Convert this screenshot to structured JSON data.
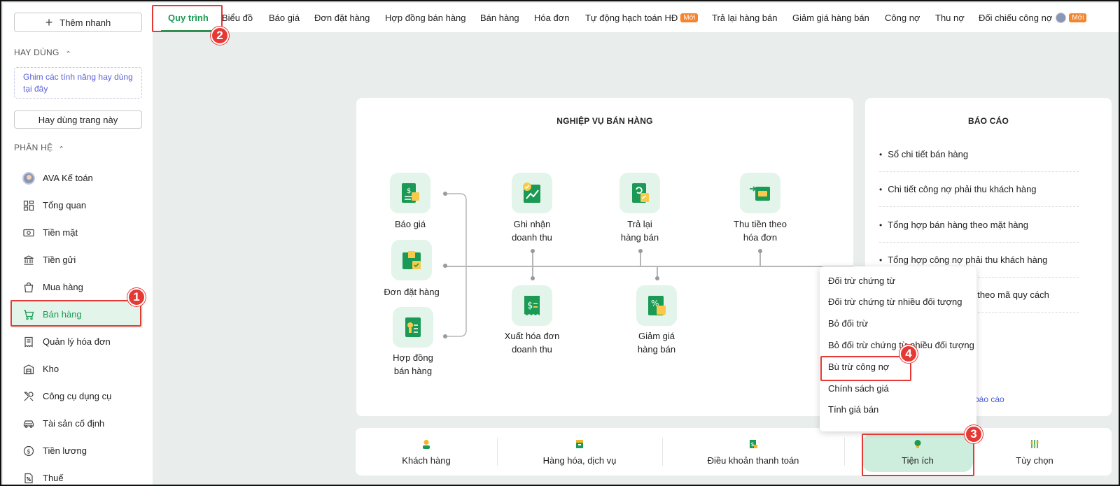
{
  "sidebar": {
    "quick_add": "Thêm nhanh",
    "frequent_title": "HAY DÙNG",
    "pin_hint": "Ghim các tính năng hay dùng tại đây",
    "frequent_button": "Hay dùng trang này",
    "modules_title": "PHÂN HỆ",
    "items": [
      {
        "label": "AVA Kế toán",
        "icon": "avatar-icon"
      },
      {
        "label": "Tổng quan",
        "icon": "dashboard-icon"
      },
      {
        "label": "Tiền mặt",
        "icon": "cash-icon"
      },
      {
        "label": "Tiền gửi",
        "icon": "bank-icon"
      },
      {
        "label": "Mua hàng",
        "icon": "shopping-bag-icon"
      },
      {
        "label": "Bán hàng",
        "icon": "cart-icon"
      },
      {
        "label": "Quản lý hóa đơn",
        "icon": "invoice-icon"
      },
      {
        "label": "Kho",
        "icon": "warehouse-icon"
      },
      {
        "label": "Công cụ dụng cụ",
        "icon": "tools-icon"
      },
      {
        "label": "Tài sản cố định",
        "icon": "car-icon"
      },
      {
        "label": "Tiền lương",
        "icon": "salary-icon"
      },
      {
        "label": "Thuế",
        "icon": "tax-icon"
      }
    ]
  },
  "tabs": [
    {
      "label": "Quy trình"
    },
    {
      "label": "Biểu đồ"
    },
    {
      "label": "Báo giá"
    },
    {
      "label": "Đơn đặt hàng"
    },
    {
      "label": "Hợp đồng bán hàng"
    },
    {
      "label": "Bán hàng"
    },
    {
      "label": "Hóa đơn"
    },
    {
      "label": "Tự động hạch toán HĐ",
      "badge": "Mới"
    },
    {
      "label": "Trả lại hàng bán"
    },
    {
      "label": "Giảm giá hàng bán"
    },
    {
      "label": "Công nợ"
    },
    {
      "label": "Thu nợ"
    },
    {
      "label": "Đối chiếu công nợ",
      "badge": "Mới"
    }
  ],
  "process": {
    "title": "NGHIỆP VỤ BÁN HÀNG",
    "nodes": {
      "bao_gia": "Báo giá",
      "don_dat_hang": "Đơn đặt hàng",
      "hop_dong_1": "Hợp đồng",
      "hop_dong_2": "bán hàng",
      "ghi_nhan_1": "Ghi nhận",
      "ghi_nhan_2": "doanh thu",
      "tra_lai_1": "Trả lại",
      "tra_lai_2": "hàng bán",
      "thu_tien_1": "Thu tiền theo",
      "thu_tien_2": "hóa đơn",
      "xuat_hd_1": "Xuất hóa đơn",
      "xuat_hd_2": "doanh thu",
      "giam_gia_1": "Giảm giá",
      "giam_gia_2": "hàng bán"
    }
  },
  "reports": {
    "title": "BÁO CÁO",
    "items": [
      "Sổ chi tiết bán hàng",
      "Chi tiết công nợ phải thu khách hàng",
      "Tổng hợp bán hàng theo mặt hàng",
      "Tổng hợp công nợ phải thu khách hàng",
      "theo mã quy cách"
    ],
    "more": "ả báo cáo"
  },
  "bottom": {
    "customers": "Khách hàng",
    "goods": "Hàng hóa, dịch vụ",
    "payment_terms": "Điều khoản thanh toán",
    "utilities": "Tiện ích",
    "options": "Tùy chọn"
  },
  "dropdown": {
    "items": [
      "Đối trừ chứng từ",
      "Đối trừ chứng từ nhiều đối tượng",
      "Bỏ đối trừ",
      "Bỏ đối trừ chứng từ nhiều đối tượng",
      "Bù trừ công nợ",
      "Chính sách giá",
      "Tính giá bán"
    ]
  },
  "markers": [
    "1",
    "2",
    "3",
    "4"
  ],
  "colors": {
    "accent": "#1a9a54",
    "highlight": "#e53935",
    "badge": "#f5842c"
  }
}
